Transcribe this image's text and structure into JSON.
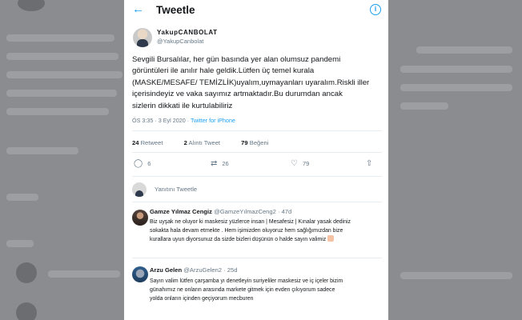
{
  "header": {
    "title": "Tweetle"
  },
  "author": {
    "name": "YakupCANBOLAT",
    "handle": "@YakupCanbolat"
  },
  "tweet": {
    "lines": [
      "Sevgili Bursalılar, her gün basında yer alan olumsuz pandemi",
      "görüntüleri ile  anılır hale geldik.Lütfen üç temel kurala",
      "(MASKE/MESAFE/ TEMİZLİK)uyalım,uymayanları uyaralım.Riskli iller",
      "içerisindeyiz ve vaka sayımız artmaktadır.Bu durumdan ancak",
      "sizlerin dikkati ile kurtulabiliriz"
    ],
    "time": "ÖS 3:35 · 3 Eyl 2020 · ",
    "source": "Twitter for iPhone"
  },
  "stats": {
    "likes_count": "24",
    "retweets_label": "Retweet",
    "quote_count": "2",
    "quote_label": "Alıntı Tweet",
    "like_count": "79",
    "like_label": "Beğeni"
  },
  "actions": {
    "reply_count": "6",
    "retweet_count": "26",
    "like_count": "79"
  },
  "reply_box": {
    "placeholder": "Yanıtını Tweetle"
  },
  "comments": [
    {
      "name": "Gamze Yılmaz Cengiz",
      "handle": "@GamzeYılmazCeng2 · 47d",
      "lines": [
        "Biz uyşak ne oluyor ki maskesiz yüzlerce insan | Mesafesiz | Kınalar yasak dediniz",
        "sokakta hala devam etmekte . Hem işimizden oluyoruz hem sağlığımızdan bize",
        "kurallara uyun diyorsunuz da sizde bizleri düşünün o halde sayın valimiz"
      ]
    },
    {
      "name": "Arzu Gelen",
      "handle": "@ArzuGelen2 · 25d",
      "lines": [
        "Sayın valim lütfen çarşamba yı denetleyin suriyeliler maskesiz ve iç içeler bizim",
        "günahımız ne onların arasında markete gitmek için evden çıkıyorum sadece",
        "yolda onların içinden geçiyorum mecburen"
      ]
    }
  ]
}
